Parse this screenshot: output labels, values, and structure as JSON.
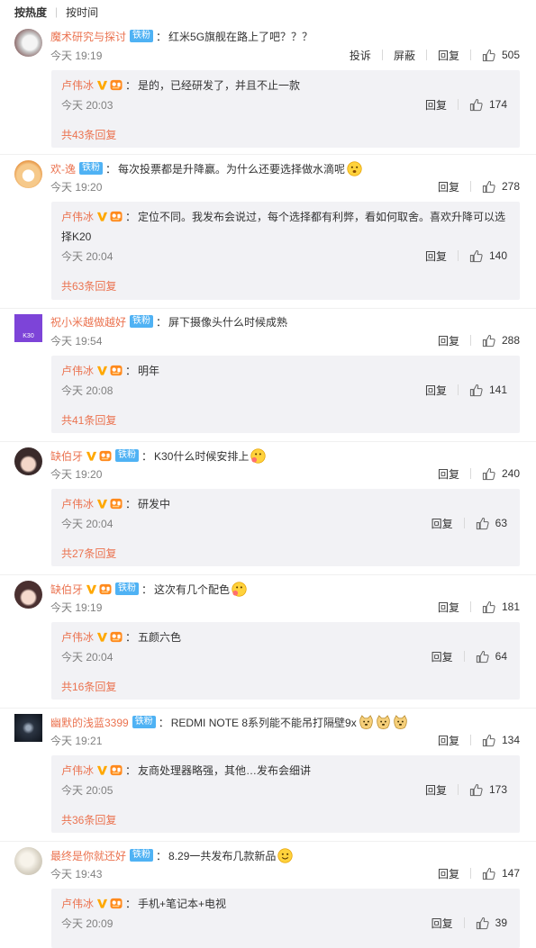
{
  "sort": {
    "hot": "按热度",
    "time": "按时间"
  },
  "actions": {
    "report": "投诉",
    "block": "屏蔽",
    "reply": "回复"
  },
  "colors": {
    "username": "#eb7350",
    "fan_badge": "#4fb2f4",
    "reply_bg": "#f2f2f5",
    "time": "#808080"
  },
  "comments": [
    {
      "user": "魔术研究与探讨",
      "badge": "铁粉",
      "text": "红米5G旗舰在路上了吧？？？",
      "time": "今天 19:19",
      "likes": "505",
      "avatar_icon": "avatar-icon",
      "reply": {
        "user": "卢伟冰",
        "text": "是的，已经研发了，并且不止一款",
        "time": "今天 20:03",
        "likes": "174"
      },
      "more": "共43条回复"
    },
    {
      "user": "欢-逸",
      "badge": "铁粉",
      "text": "每次投票都是升降赢。为什么还要选择做水滴呢",
      "time": "今天 19:20",
      "likes": "278",
      "emoji": "wonder-emoji",
      "reply": {
        "user": "卢伟冰",
        "text1": "定位不同。我发布会说过，每个选择都有利弊，看如何取舍。喜欢升降可以选",
        "text2": "择K20",
        "time": "今天 20:04",
        "likes": "140"
      },
      "more": "共63条回复"
    },
    {
      "user": "祝小米越做越好",
      "badge": "铁粉",
      "text": "屏下摄像头什么时候成熟",
      "time": "今天 19:54",
      "likes": "288",
      "avatar_text": "K30",
      "reply": {
        "user": "卢伟冰",
        "text": "明年",
        "time": "今天 20:08",
        "likes": "141"
      },
      "more": "共41条回复"
    },
    {
      "user": "缺伯牙",
      "badge": "铁粉",
      "text": "K30什么时候安排上",
      "time": "今天 19:20",
      "likes": "240",
      "emoji": "think-emoji",
      "reply": {
        "user": "卢伟冰",
        "text": "研发中",
        "time": "今天 20:04",
        "likes": "63"
      },
      "more": "共27条回复"
    },
    {
      "user": "缺伯牙",
      "badge": "铁粉",
      "text": "这次有几个配色",
      "time": "今天 19:19",
      "likes": "181",
      "emoji": "think-emoji",
      "reply": {
        "user": "卢伟冰",
        "text": "五颜六色",
        "time": "今天 20:04",
        "likes": "64"
      },
      "more": "共16条回复"
    },
    {
      "user": "幽默的浅蓝3399",
      "badge": "铁粉",
      "text": "REDMI NOTE 8系列能不能吊打隔壁9x",
      "time": "今天 19:21",
      "likes": "134",
      "emoji": "doge-emoji",
      "reply": {
        "user": "卢伟冰",
        "text": "友商处理器略强，其他…发布会细讲",
        "time": "今天 20:05",
        "likes": "173"
      },
      "more": "共36条回复"
    },
    {
      "user": "最终是你就还好",
      "badge": "铁粉",
      "text": "8.29一共发布几款新品",
      "time": "今天 19:43",
      "likes": "147",
      "emoji": "smile-emoji",
      "reply": {
        "user": "卢伟冰",
        "text": "手机+笔记本+电视",
        "time": "今天 20:09",
        "likes": "39"
      }
    }
  ]
}
